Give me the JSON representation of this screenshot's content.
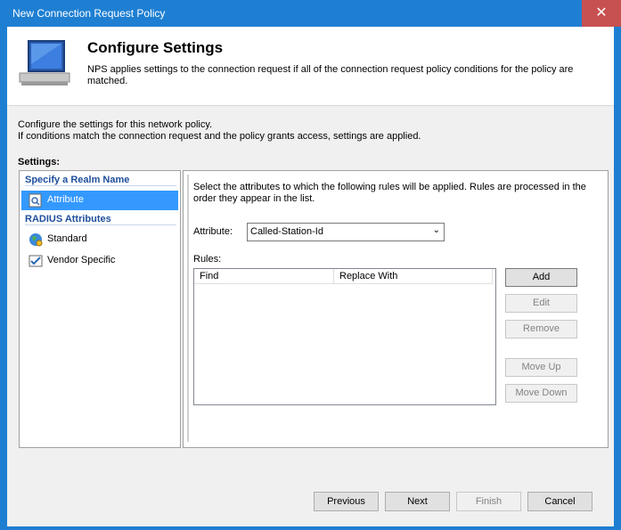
{
  "window": {
    "title": "New Connection Request Policy",
    "close_label": "✕"
  },
  "header": {
    "title": "Configure Settings",
    "description": "NPS applies settings to the connection request if all of the connection request policy conditions  for the policy are matched."
  },
  "intro": {
    "line1": "Configure the settings for this network policy.",
    "line2": "If conditions match the connection request and the policy grants access, settings are applied."
  },
  "settings_label": "Settings:",
  "left_nav": {
    "category1": "Specify a Realm Name",
    "category2": "RADIUS Attributes",
    "items": [
      {
        "label": "Attribute",
        "icon": "attribute-icon",
        "selected": true
      },
      {
        "label": "Standard",
        "icon": "globe-icon",
        "selected": false
      },
      {
        "label": "Vendor Specific",
        "icon": "checkbox-icon",
        "selected": false
      }
    ]
  },
  "right": {
    "description": "Select the attributes to which the following rules will be applied. Rules are processed in the order they appear in the list.",
    "attribute_label": "Attribute:",
    "attribute_value": "Called-Station-Id",
    "rules_label": "Rules:",
    "columns": [
      "Find",
      "Replace With"
    ],
    "buttons": {
      "add": "Add",
      "edit": "Edit",
      "remove": "Remove",
      "move_up": "Move Up",
      "move_down": "Move Down"
    }
  },
  "footer": {
    "previous": "Previous",
    "next": "Next",
    "finish": "Finish",
    "cancel": "Cancel"
  },
  "colors": {
    "titlebar": "#1e7fd2",
    "close": "#c75050",
    "selection": "#3399ff",
    "category": "#1e4e9c"
  }
}
